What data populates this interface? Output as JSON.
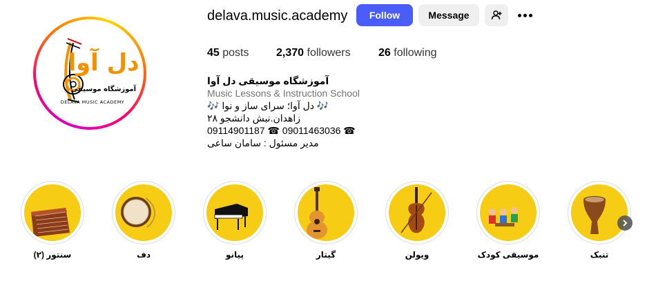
{
  "profile": {
    "username": "delava.music.academy",
    "follow_label": "Follow",
    "message_label": "Message",
    "posts_count": "45",
    "posts_label": "posts",
    "followers_count": "2,370",
    "followers_label": "followers",
    "following_count": "26",
    "following_label": "following"
  },
  "avatar": {
    "logo_text": "دل آوا",
    "subtitle_fa": "آموزشگاه موسیقی",
    "subtitle_en": "DELAVA MUSIC ACADEMY"
  },
  "bio": {
    "name": "آموزشگاه موسیقی دل آوا",
    "category": "Music Lessons & Instruction School",
    "line1": "🎶 دل آوا؛ سرای ساز و نوا 🎶",
    "line2": "زاهدان.نبش دانشجو ۲۸",
    "line3": "09114901187 ☎ 09011463036 ☎",
    "line4": "مدیر مسئول : سامان ساعی"
  },
  "highlights": [
    {
      "label": "سنتور (۲)"
    },
    {
      "label": "دف"
    },
    {
      "label": "پیانو"
    },
    {
      "label": "گیتار"
    },
    {
      "label": "ویولن"
    },
    {
      "label": "موسیقی کودک"
    },
    {
      "label": "تنبک"
    }
  ],
  "colors": {
    "follow_button": "#4a5df9",
    "highlight_bg": "#f7cc14",
    "logo_orange": "#f39200"
  }
}
